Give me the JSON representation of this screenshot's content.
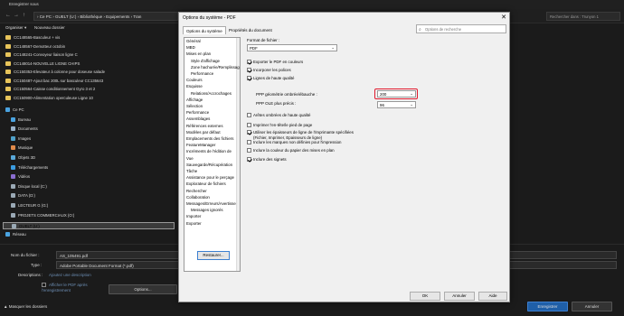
{
  "window": {
    "title": "Enregistrer sous"
  },
  "address": {
    "breadcrumb": "›  Ce PC  ›  GUELT (U:)  ›  Bibliothèque  ›  Equipements  ›  Tran",
    "search_placeholder": "Rechercher dans : Trunyon 1"
  },
  "toolbar": {
    "organize": "Organiser ▾",
    "new_folder": "Nouveau dossier"
  },
  "files": [
    "CC148565-Basculeur + vis",
    "CC148567-Demotteur octobin",
    "CC148241-Convoyeur liaison ligne C",
    "CC148014-NOUVELLE LIGNE CHIPS",
    "CC150353-Elevateur à colonne pour doseuse salade",
    "CC150487-Ajout bac 200L sur basculeur CC135643",
    "CC150564-Caisse conditionnement Gyro 3 et 2",
    "CC150900-Alimentation operculeuse Ligne 10"
  ],
  "nav": [
    {
      "label": "Ce PC",
      "color": "#4aa3e0",
      "indent": 0
    },
    {
      "label": "Bureau",
      "color": "#4aa3e0",
      "indent": 1
    },
    {
      "label": "Documents",
      "color": "#9ab2c9",
      "indent": 1
    },
    {
      "label": "Images",
      "color": "#4fa0c9",
      "indent": 1
    },
    {
      "label": "Musique",
      "color": "#e08a4a",
      "indent": 1
    },
    {
      "label": "Objets 3D",
      "color": "#59a8d9",
      "indent": 1
    },
    {
      "label": "Téléchargements",
      "color": "#3b9ce0",
      "indent": 1
    },
    {
      "label": "Vidéos",
      "color": "#8a6dd0",
      "indent": 1
    },
    {
      "label": "Disque local (C:)",
      "color": "#9aa9b5",
      "indent": 1
    },
    {
      "label": "DATA (D:)",
      "color": "#9aa9b5",
      "indent": 1
    },
    {
      "label": "LECTEUR G (G:)",
      "color": "#9aa9b5",
      "indent": 1
    },
    {
      "label": "PROJETS COMMERCIAUX (O:)",
      "color": "#9aa9b5",
      "indent": 1
    },
    {
      "label": "GUELT (U:)",
      "color": "#9aa9b5",
      "indent": 1,
      "selected": true
    },
    {
      "label": "Réseau",
      "color": "#4aa3e0",
      "indent": 0
    }
  ],
  "bottom": {
    "filename_label": "Nom du fichier :",
    "filename_value": "AS_105491.pdf",
    "type_label": "Type :",
    "type_value": "Adobe Portable Document Format (*.pdf)",
    "desc_label": "Descriptions :",
    "desc_value": "Ajoutez une description",
    "open_pdf_label": "Afficher le PDF après l'enregistrement",
    "options_button": "Options...",
    "hide_folders": "Masquer les dossiers",
    "save_button": "Enregistrer",
    "cancel_button": "Annuler"
  },
  "dialog": {
    "title": "Options du système - PDF",
    "close": "✕",
    "tabs": [
      "Options du système",
      "Propriétés du document"
    ],
    "search_placeholder": "Options de recherche",
    "tree": [
      {
        "label": "Général",
        "indent": 0
      },
      {
        "label": "MBD",
        "indent": 0
      },
      {
        "label": "Mises en plan",
        "indent": 0
      },
      {
        "label": "Style d'affichage",
        "indent": 1
      },
      {
        "label": "Zone hachurée/Remplissage",
        "indent": 1
      },
      {
        "label": "Performance",
        "indent": 1
      },
      {
        "label": "Couleurs",
        "indent": 0
      },
      {
        "label": "Esquisse",
        "indent": 0
      },
      {
        "label": "Relations/Accrochages",
        "indent": 1
      },
      {
        "label": "Affichage",
        "indent": 0
      },
      {
        "label": "Sélection",
        "indent": 0
      },
      {
        "label": "Performance",
        "indent": 0
      },
      {
        "label": "Assemblages",
        "indent": 0
      },
      {
        "label": "Références externes",
        "indent": 0
      },
      {
        "label": "Modèles par défaut",
        "indent": 0
      },
      {
        "label": "Emplacements des fichiers",
        "indent": 0
      },
      {
        "label": "FeatureManager",
        "indent": 0
      },
      {
        "label": "Incréments de l'édition de",
        "indent": 0
      },
      {
        "label": "Vue",
        "indent": 0
      },
      {
        "label": "Sauvegarde/Récupération",
        "indent": 0
      },
      {
        "label": "Tâche",
        "indent": 0
      },
      {
        "label": "Assistance pour le perçage",
        "indent": 0
      },
      {
        "label": "Explorateur de fichiers",
        "indent": 0
      },
      {
        "label": "Rechercher",
        "indent": 0
      },
      {
        "label": "Collaboration",
        "indent": 0
      },
      {
        "label": "Messages/Erreurs/Avertisse",
        "indent": 0
      },
      {
        "label": "Messages ignorés",
        "indent": 1
      },
      {
        "label": "Importer",
        "indent": 0
      },
      {
        "label": "Exporter",
        "indent": 0
      }
    ],
    "restore_button": "Restaurer...",
    "format_label": "Format de fichier :",
    "format_value": "PDF",
    "options": [
      {
        "label": "Exporter le PDF en couleurs",
        "checked": true
      },
      {
        "label": "Incorporer les polices",
        "checked": true
      },
      {
        "label": "Lignes de haute qualité",
        "checked": true
      }
    ],
    "dpi_shaded_label": "PPP géométrie ombrée/ébauche :",
    "dpi_shaded_value": "200",
    "dpi_ole_label": "PPP OLE plus précis :",
    "dpi_ole_value": "96",
    "options2": [
      {
        "label": "Arêtes ombrées de haute qualité",
        "checked": false
      },
      {
        "label": "Imprimer l'en-tête/le pied de page",
        "checked": false
      },
      {
        "label": "Utiliser les épaisseurs de ligne de l'imprimante spécifiées (Fichier, Imprimer, Epaisseurs de ligne)",
        "checked": true
      },
      {
        "label": "Inclure les marques non définies pour l'impression",
        "checked": false
      },
      {
        "label": "Inclure la couleur du papier des mises en plan",
        "checked": false
      },
      {
        "label": "Inclure des signets",
        "checked": true
      }
    ],
    "ok_button": "OK",
    "cancel_button": "Annuler",
    "help_button": "Aide"
  }
}
